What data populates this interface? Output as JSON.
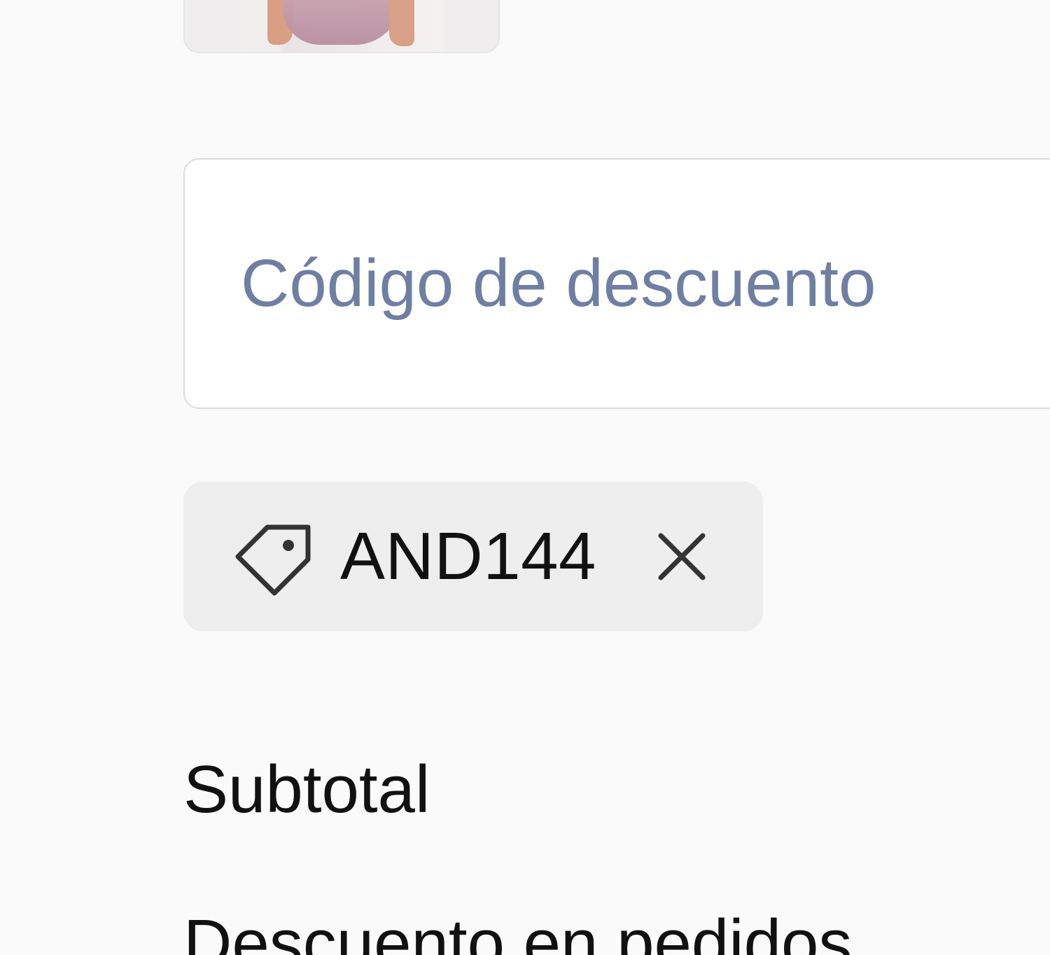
{
  "discount": {
    "placeholder": "Código de descuento",
    "value": ""
  },
  "coupon": {
    "code": "AND144",
    "icon": "tag-icon",
    "remove_icon": "close-icon"
  },
  "summary": {
    "subtotal_label": "Subtotal",
    "order_discount_label": "Descuento en pedidos"
  },
  "colors": {
    "placeholder": "#6f7fa3",
    "chip_background": "#eeeeee",
    "page_background": "#fafafa"
  }
}
